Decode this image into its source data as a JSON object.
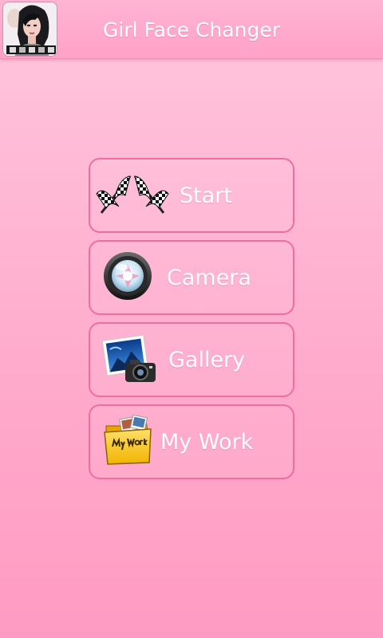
{
  "app": {
    "title": "Girl Face Changer"
  },
  "menu": {
    "start_label": "Start",
    "camera_label": "Camera",
    "gallery_label": "Gallery",
    "mywork_label": "My Work"
  },
  "icons": {
    "start": "checkered-flags-icon",
    "camera": "camera-lens-icon",
    "gallery": "photo-gallery-camera-icon",
    "mywork": "my-work-folder-icon"
  },
  "colors": {
    "background": "#ffb4d3",
    "button_border": "#ee6f9f",
    "text": "#ffffff"
  }
}
